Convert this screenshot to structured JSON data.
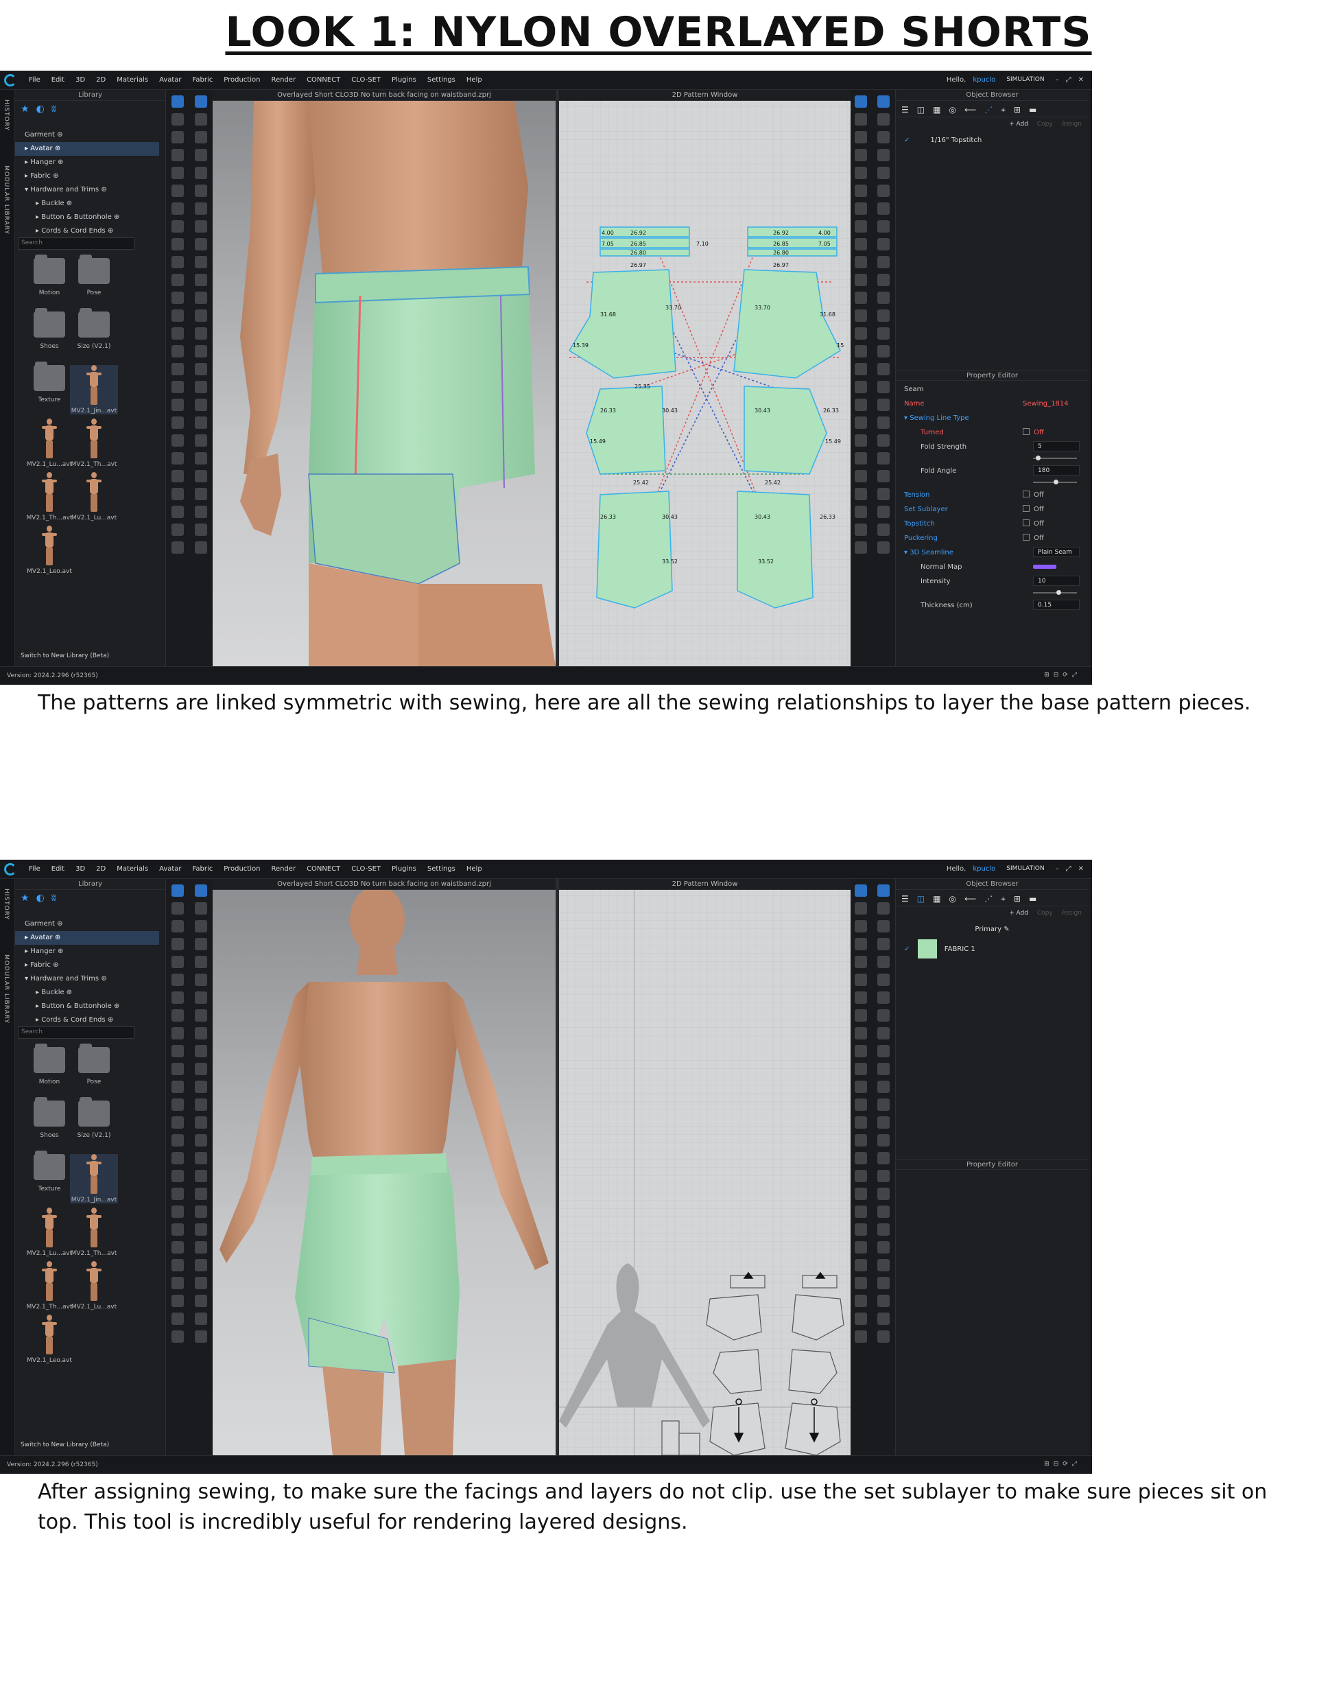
{
  "page": {
    "title": "LOOK 1: NYLON OVERLAYED SHORTS",
    "caption1": "The patterns are linked symmetric with sewing, here are all the sewing relationships to layer the base pattern pieces.",
    "caption2": "After assigning sewing, to make sure the facings and layers do not clip. use the set sublayer to make sure pieces sit on top. This tool is incredibly useful for rendering layered designs."
  },
  "app": {
    "menu": [
      "File",
      "Edit",
      "3D",
      "2D",
      "Materials",
      "Avatar",
      "Fabric",
      "Production",
      "Render",
      "CONNECT",
      "CLO-SET",
      "Plugins",
      "Settings",
      "Help"
    ],
    "hello": "Hello,",
    "user": "kpuclo",
    "mode": "SIMULATION",
    "side_tabs": [
      "HISTORY",
      "MODULAR LIBRARY"
    ],
    "library_title": "Library",
    "tree": [
      {
        "label": "Garment",
        "level": 0,
        "selected": false
      },
      {
        "label": "Avatar",
        "level": 0,
        "selected": true
      },
      {
        "label": "Hanger",
        "level": 0,
        "selected": false
      },
      {
        "label": "Fabric",
        "level": 0,
        "selected": false
      },
      {
        "label": "Hardware and Trims",
        "level": 0,
        "selected": false
      },
      {
        "label": "Buckle",
        "level": 1,
        "selected": false
      },
      {
        "label": "Button & Buttonhole",
        "level": 1,
        "selected": false
      },
      {
        "label": "Cords & Cord Ends",
        "level": 1,
        "selected": false
      }
    ],
    "search_placeholder": "Search",
    "grid_items": [
      {
        "label": "Motion",
        "kind": "folder"
      },
      {
        "label": "Pose",
        "kind": "folder"
      },
      {
        "label": "Shoes",
        "kind": "folder"
      },
      {
        "label": "Size (V2.1)",
        "kind": "folder"
      },
      {
        "label": "Texture",
        "kind": "folder"
      },
      {
        "label": "MV2.1_Jin...avt",
        "kind": "avatar"
      },
      {
        "label": "MV2.1_Lu...avt",
        "kind": "avatar"
      },
      {
        "label": "MV2.1_Th...avt",
        "kind": "avatar"
      },
      {
        "label": "MV2.1_Th...avt",
        "kind": "avatar"
      },
      {
        "label": "MV2.1_Lu...avt",
        "kind": "avatar"
      },
      {
        "label": "MV2.1_Leo.avt",
        "kind": "avatar"
      }
    ],
    "switch_library": "Switch to New Library (Beta)",
    "viewport_title": "Overlayed Short CLO3D No turn back facing on waistband.zprj",
    "pattern_title": "2D Pattern Window",
    "object_browser_title": "Object Browser",
    "add_label": "+ Add",
    "copy_label": "Copy",
    "assign_label": "Assign",
    "property_editor_title": "Property Editor",
    "version": "Version: 2024.2.296 (r52365)"
  },
  "shot1": {
    "object_item": "1/16\" Topstitch",
    "measurements": [
      "4.00",
      "26.92",
      "26.92",
      "4.00",
      "7.05",
      "26.85",
      "7.10",
      "26.85",
      "7.05",
      "26.80",
      "26.80",
      "26.97",
      "26.97",
      "31.68",
      "33.70",
      "33.70",
      "31.68",
      "15.39",
      "15",
      "25.35",
      "26.33",
      "30.43",
      "30.43",
      "26.33",
      "15.49",
      "15.49",
      "25.42",
      "25.42",
      "26.33",
      "30.43",
      "30.43",
      "26.33",
      "33.52",
      "33.52"
    ],
    "properties": {
      "section": "Seam",
      "name_label": "Name",
      "name_value": "Sewing_1814",
      "sewing_line_type": "Sewing Line Type",
      "turned_label": "Turned",
      "turned_value": "Off",
      "fold_strength_label": "Fold Strength",
      "fold_strength_value": "5",
      "fold_angle_label": "Fold Angle",
      "fold_angle_value": "180",
      "tension_label": "Tension",
      "tension_value": "Off",
      "sublayer_label": "Set Sublayer",
      "sublayer_value": "Off",
      "topstitch_label": "Topstitch",
      "topstitch_value": "Off",
      "puckering_label": "Puckering",
      "puckering_value": "Off",
      "seamline_label": "3D Seamline",
      "seamline_value": "Plain Seam",
      "normal_map_label": "Normal Map",
      "intensity_label": "Intensity",
      "intensity_value": "10",
      "thickness_label": "Thickness (cm)",
      "thickness_value": "0.15"
    }
  },
  "shot2": {
    "layer_label": "Primary",
    "fabric_name": "FABRIC 1",
    "fabric_color": "#a8e0b4"
  },
  "colors": {
    "garment": "#a9dbb4",
    "pattern_fill": "#aee3bd",
    "accent": "#3aa0ff"
  }
}
